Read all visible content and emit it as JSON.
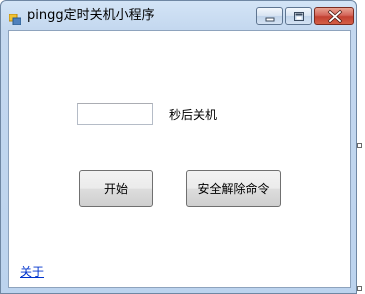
{
  "window": {
    "title": "pingg定时关机小程序"
  },
  "form": {
    "seconds_value": "",
    "suffix_label": "秒后关机",
    "start_button": "开始",
    "safe_cancel_button": "安全解除命令",
    "about_link": "关于"
  },
  "colors": {
    "title_gradient_top": "#d3e4f6",
    "close_button": "#c34132",
    "link": "#0033cc"
  },
  "icons": {
    "app": "windows-form-icon",
    "minimize": "minimize-icon",
    "maximize": "maximize-icon",
    "close": "close-icon"
  }
}
